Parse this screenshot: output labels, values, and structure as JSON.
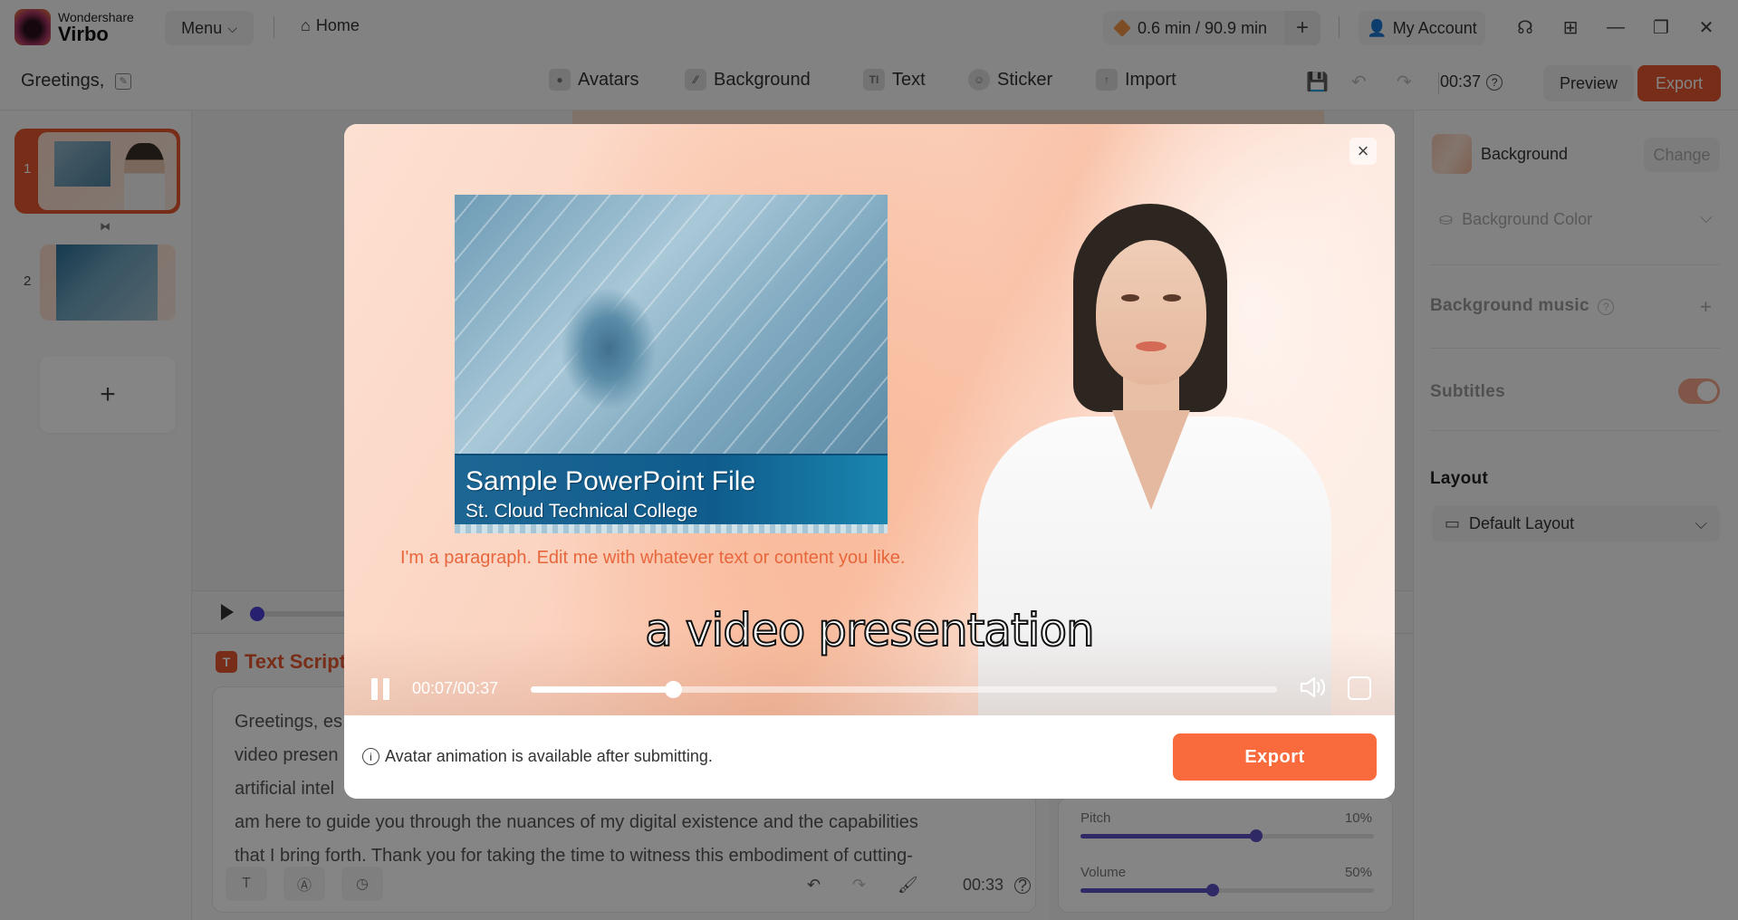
{
  "app": {
    "brand_top": "Wondershare",
    "brand_name": "Virbo",
    "menu_label": "Menu",
    "home_label": "Home",
    "quota": "0.6 min / 90.9 min",
    "account_label": "My Account"
  },
  "toolbar": {
    "project_title": "Greetings,",
    "tools": [
      {
        "label": "Avatars",
        "icon": "avatar-icon"
      },
      {
        "label": "Background",
        "icon": "background-icon"
      },
      {
        "label": "Text",
        "icon": "text-icon"
      },
      {
        "label": "Sticker",
        "icon": "sticker-icon"
      },
      {
        "label": "Import",
        "icon": "import-icon"
      }
    ],
    "duration": "00:37",
    "preview_label": "Preview",
    "export_label": "Export"
  },
  "sidebar": {
    "slides": [
      {
        "number": "1",
        "selected": true
      },
      {
        "number": "2",
        "selected": false
      }
    ],
    "add_label": "+"
  },
  "script": {
    "title": "Text Script",
    "lines": [
      "Greetings, es",
      "video presen",
      "artificial intel",
      "am here to guide you through the nuances of my digital existence and the capabilities",
      "that I bring forth. Thank you for taking the time to witness this embodiment of cutting-"
    ],
    "duration": "00:33"
  },
  "voice": {
    "pitch": {
      "label": "Pitch",
      "value": "10%",
      "position": 0.6
    },
    "volume": {
      "label": "Volume",
      "value": "50%",
      "position": 0.45
    }
  },
  "right_panel": {
    "background_label": "Background",
    "change_label": "Change",
    "background_color_label": "Background Color",
    "background_music_label": "Background music",
    "subtitles_label": "Subtitles",
    "subtitles_on": true,
    "layout_heading": "Layout",
    "layout_value": "Default Layout"
  },
  "modal": {
    "slide_title": "Sample PowerPoint File",
    "slide_subtitle": "St. Cloud Technical College",
    "paragraph": "I'm a paragraph. Edit me with whatever text or content you like.",
    "subtitle": "a video presentation",
    "time": "00:07/00:37",
    "progress": 0.19,
    "info": "Avatar animation is available after submitting.",
    "export_label": "Export",
    "close_label": "×"
  }
}
